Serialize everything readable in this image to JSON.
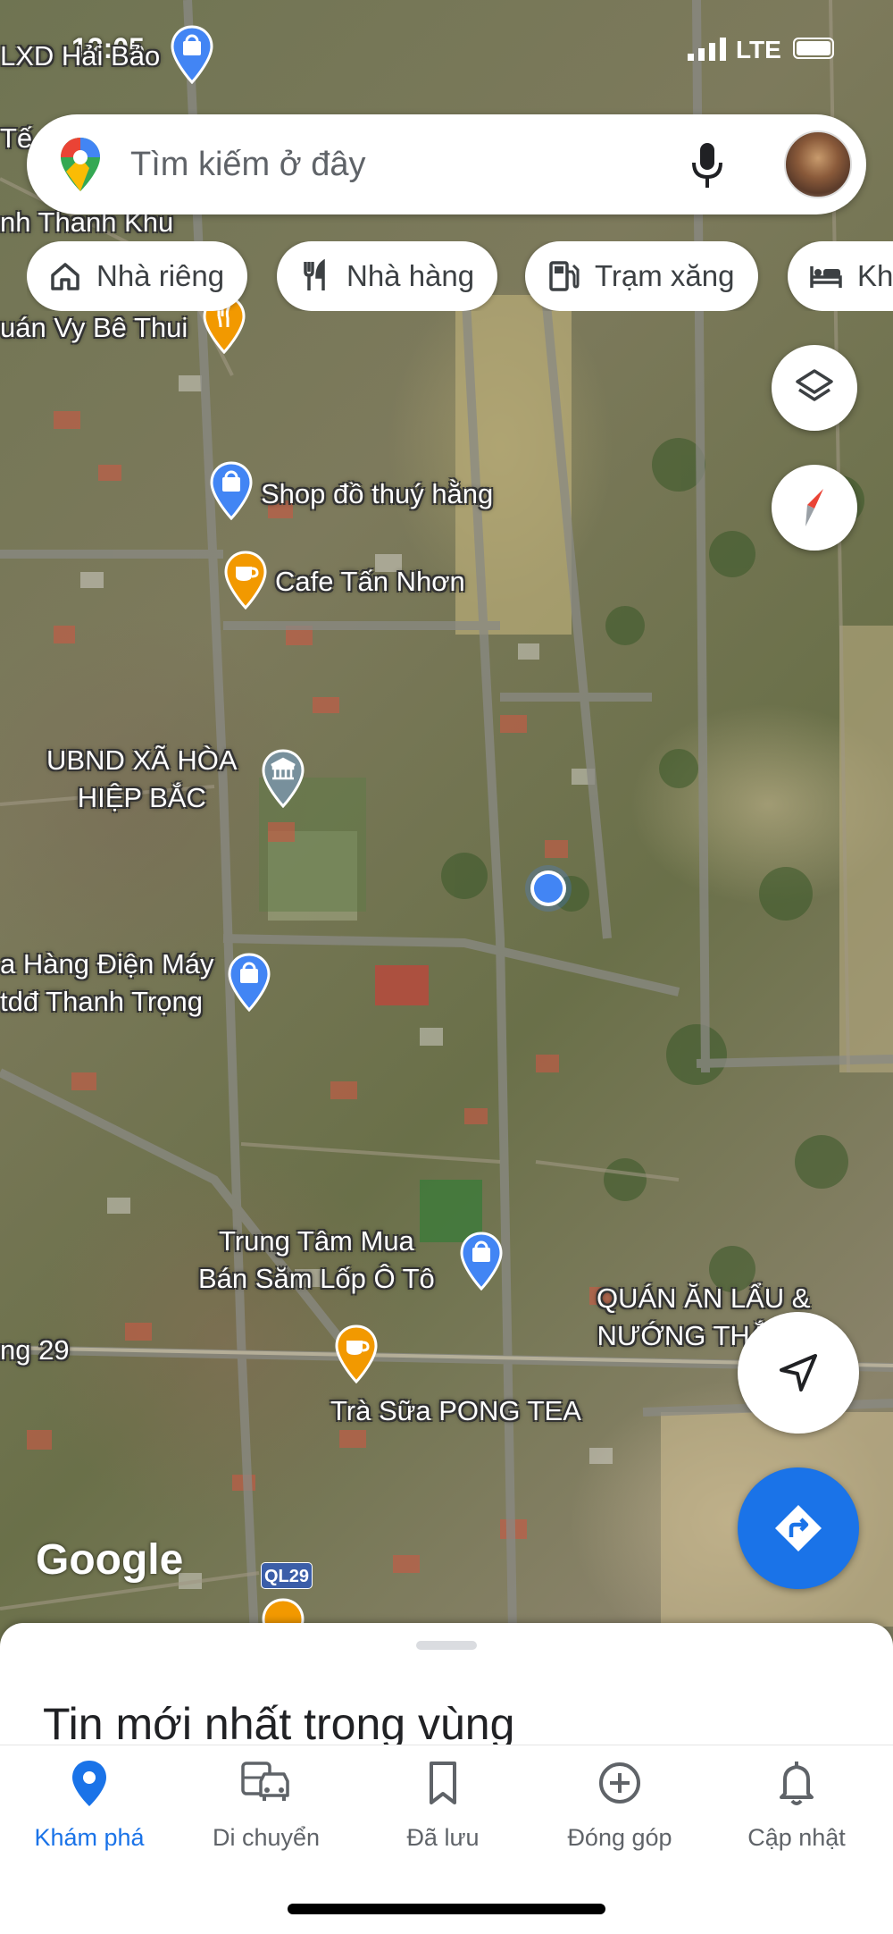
{
  "status_bar": {
    "time": "12:05",
    "network": "LTE"
  },
  "search": {
    "placeholder": "Tìm kiếm ở đây"
  },
  "chips": [
    {
      "label": "Nhà riêng",
      "icon": "home-icon"
    },
    {
      "label": "Nhà hàng",
      "icon": "restaurant-icon"
    },
    {
      "label": "Trạm xăng",
      "icon": "gas-station-icon"
    },
    {
      "label": "Khách sạn",
      "icon": "hotel-icon"
    }
  ],
  "map": {
    "places": [
      {
        "name": "LXD Hải Bảo",
        "icon": "shopping-bag-pin-icon"
      },
      {
        "name": "Tế",
        "icon": "none"
      },
      {
        "name": "nh Thanh Khu",
        "icon": "shopping-bag-pin-icon"
      },
      {
        "name": "uán Vy Bê Thui",
        "icon": "restaurant-pin-icon"
      },
      {
        "name": "Shop đồ thuý hằng",
        "icon": "shopping-bag-pin-icon"
      },
      {
        "name": "Cafe Tấn Nhơn",
        "icon": "cafe-pin-icon"
      },
      {
        "name": "UBND XÃ HÒA\nHIỆP BẮC",
        "icon": "government-pin-icon"
      },
      {
        "name": "a Hàng Điện Máy\ntdđ Thanh Trọng",
        "icon": "shopping-bag-pin-icon"
      },
      {
        "name": "Trung Tâm Mua\nBán Săm Lốp Ô Tô",
        "icon": "shopping-bag-pin-icon"
      },
      {
        "name": "QUÁN ĂN LẨU &\nNƯỚNG THẮNG",
        "icon": "none"
      },
      {
        "name": "ng 29",
        "icon": "none"
      },
      {
        "name": "Trà Sữa PONG TEA",
        "icon": "cafe-pin-icon"
      }
    ],
    "route_shield": "QL29",
    "attribution": "Google"
  },
  "sheet": {
    "title": "Tin mới nhất trong vùng"
  },
  "nav": [
    {
      "label": "Khám phá",
      "icon": "explore-pin-icon",
      "active": true
    },
    {
      "label": "Di chuyển",
      "icon": "commute-icon",
      "active": false
    },
    {
      "label": "Đã lưu",
      "icon": "bookmark-icon",
      "active": false
    },
    {
      "label": "Đóng góp",
      "icon": "add-circle-icon",
      "active": false
    },
    {
      "label": "Cập nhật",
      "icon": "bell-icon",
      "active": false
    }
  ],
  "colors": {
    "accent": "#1a73e8",
    "location_dot": "#4285f4",
    "directions_fab": "#1a73e8"
  }
}
